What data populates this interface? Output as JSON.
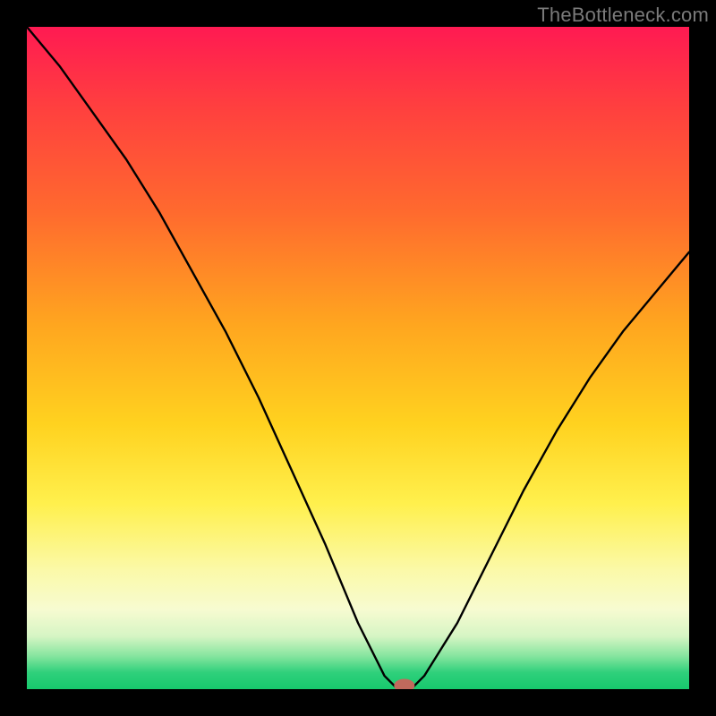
{
  "attribution": "TheBottleneck.com",
  "chart_data": {
    "type": "line",
    "title": "",
    "xlabel": "",
    "ylabel": "",
    "xlim": [
      0,
      100
    ],
    "ylim": [
      0,
      100
    ],
    "x": [
      0,
      5,
      10,
      15,
      20,
      25,
      30,
      35,
      40,
      45,
      50,
      54,
      56,
      58,
      60,
      65,
      70,
      75,
      80,
      85,
      90,
      95,
      100
    ],
    "values": [
      100,
      94,
      87,
      80,
      72,
      63,
      54,
      44,
      33,
      22,
      10,
      2,
      0,
      0,
      2,
      10,
      20,
      30,
      39,
      47,
      54,
      60,
      66
    ],
    "marker": {
      "x": 57,
      "y": 0
    },
    "background_gradient_stops": [
      {
        "pos": 0.0,
        "color": "#ff1a52"
      },
      {
        "pos": 0.12,
        "color": "#ff3f3f"
      },
      {
        "pos": 0.28,
        "color": "#ff6a2e"
      },
      {
        "pos": 0.45,
        "color": "#ffa61f"
      },
      {
        "pos": 0.6,
        "color": "#ffd21f"
      },
      {
        "pos": 0.72,
        "color": "#fff04d"
      },
      {
        "pos": 0.82,
        "color": "#fbf9a8"
      },
      {
        "pos": 0.88,
        "color": "#f7fbd1"
      },
      {
        "pos": 0.92,
        "color": "#d6f5c4"
      },
      {
        "pos": 0.95,
        "color": "#86e59f"
      },
      {
        "pos": 0.975,
        "color": "#2fd07b"
      },
      {
        "pos": 1.0,
        "color": "#17c96d"
      }
    ]
  }
}
